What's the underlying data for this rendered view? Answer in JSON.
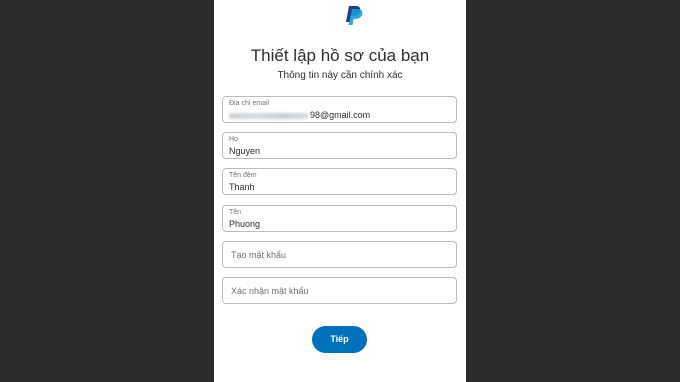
{
  "header": {
    "title": "Thiết lập hồ sơ của bạn",
    "subtitle": "Thông tin này cần chính xác"
  },
  "form": {
    "email": {
      "label": "Địa chỉ email",
      "value_visible": "98@gmail.com"
    },
    "last_name": {
      "label": "Họ",
      "value": "Nguyen"
    },
    "middle_name": {
      "label": "Tên đệm",
      "value": "Thanh"
    },
    "first_name": {
      "label": "Tên",
      "value": "Phuong"
    },
    "password": {
      "placeholder": "Tạo mật khẩu"
    },
    "confirm_password": {
      "placeholder": "Xác nhận mật khẩu"
    }
  },
  "actions": {
    "next_label": "Tiếp"
  },
  "icons": {
    "logo": "paypal-logo-icon"
  },
  "colors": {
    "brand_blue": "#0070ba",
    "logo_dark": "#253b80",
    "logo_light": "#179bd7"
  }
}
